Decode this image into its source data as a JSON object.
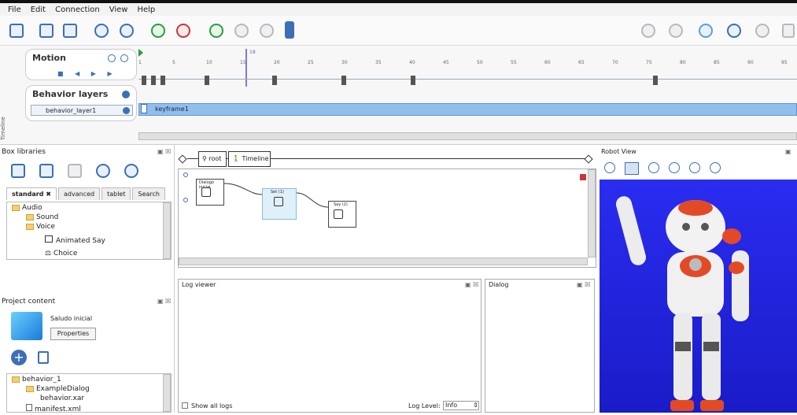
{
  "menu": [
    "File",
    "Edit",
    "Connection",
    "View",
    "Help"
  ],
  "timeline": {
    "motion_title": "Motion",
    "behavior_layers_title": "Behavior layers",
    "layer_name": "behavior_layer1",
    "keyframe_label": "keyframe1",
    "ticks": [
      "1",
      "5",
      "10",
      "15",
      "20",
      "25",
      "30",
      "35",
      "40",
      "45",
      "50",
      "55",
      "60",
      "65",
      "70",
      "75",
      "80",
      "85",
      "90",
      "95"
    ],
    "marker": "18",
    "side_label": "Timeline"
  },
  "box_libraries": {
    "title": "Box libraries",
    "tabs": [
      "standard",
      "advanced",
      "tablet",
      "Search"
    ],
    "tree": [
      "Audio",
      "Sound",
      "Voice",
      "Animated Say",
      "Choice"
    ]
  },
  "project": {
    "title": "Project content",
    "name": "Saludo inicial",
    "properties_button": "Properties",
    "tree": [
      "behavior_1",
      "ExampleDialog",
      "behavior.xar",
      "manifest.xml"
    ]
  },
  "flow": {
    "root_label": "root",
    "timeline_label": "Timeline",
    "nodes": [
      "Dialogo inicial",
      "Set (1)",
      "Say (2)"
    ]
  },
  "log": {
    "title": "Log viewer",
    "show_all": "Show all logs",
    "level_label": "Log Level:",
    "level_value": "Info"
  },
  "dialog": {
    "title": "Dialog"
  },
  "robot": {
    "title": "Robot View"
  },
  "colors": {
    "accent": "#3c6fb6",
    "layer": "#8fc0ec",
    "robot_bg": "#2a2cf0",
    "robot_orange": "#e24a26"
  }
}
